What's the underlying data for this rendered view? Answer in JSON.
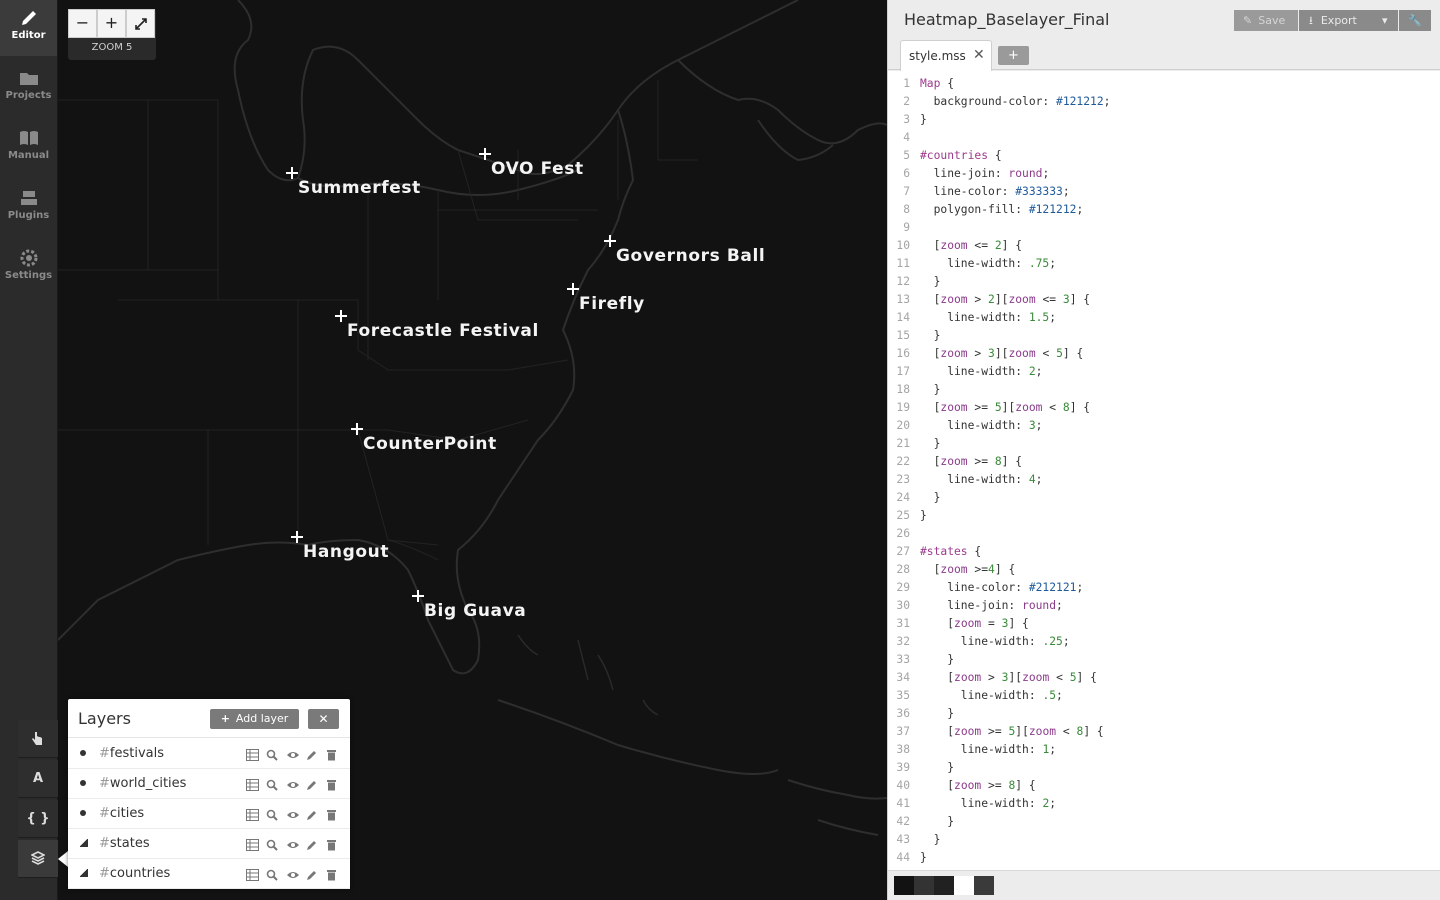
{
  "sidebar": {
    "items": [
      {
        "label": "Editor",
        "icon": "pencil-icon"
      },
      {
        "label": "Projects",
        "icon": "folder-icon"
      },
      {
        "label": "Manual",
        "icon": "book-icon"
      },
      {
        "label": "Plugins",
        "icon": "plugin-icon"
      },
      {
        "label": "Settings",
        "icon": "gear-icon"
      }
    ],
    "tools": [
      {
        "name": "hand-tool",
        "glyph": ""
      },
      {
        "name": "font-tool",
        "glyph": "A"
      },
      {
        "name": "docs-tool",
        "glyph": "{ }"
      },
      {
        "name": "layers-tool",
        "glyph": ""
      }
    ]
  },
  "map": {
    "zoom_minus": "−",
    "zoom_plus": "+",
    "zoom_label": "ZOOM 5",
    "festivals": [
      {
        "name": "Summerfest"
      },
      {
        "name": "OVO Fest"
      },
      {
        "name": "Governors Ball"
      },
      {
        "name": "Firefly"
      },
      {
        "name": "Forecastle Festival"
      },
      {
        "name": "CounterPoint"
      },
      {
        "name": "Hangout"
      },
      {
        "name": "Big Guava"
      }
    ],
    "colors": {
      "background": "#121212",
      "lines": "#333333",
      "state_lines": "#262626",
      "labels": "#ffffff"
    }
  },
  "layers_panel": {
    "title": "Layers",
    "add_label": "Add layer",
    "close_glyph": "✕",
    "hash": "#",
    "layers": [
      {
        "name": "festivals",
        "geometry": "point"
      },
      {
        "name": "world_cities",
        "geometry": "point"
      },
      {
        "name": "cities",
        "geometry": "point"
      },
      {
        "name": "states",
        "geometry": "polygon"
      },
      {
        "name": "countries",
        "geometry": "polygon"
      }
    ]
  },
  "editor": {
    "project_title": "Heatmap_Baselayer_Final",
    "save_label": "Save",
    "export_label": "Export",
    "tab_name": "style.mss",
    "tab_close": "✕",
    "add_tab": "+",
    "code_lines": [
      "Map {",
      "  background-color: #121212;",
      "}",
      "",
      "#countries {",
      "  line-join: round;",
      "  line-color: #333333;",
      "  polygon-fill: #121212;",
      "",
      "  [zoom <= 2] {",
      "    line-width: .75;",
      "  }",
      "  [zoom > 2][zoom <= 3] {",
      "    line-width: 1.5;",
      "  }",
      "  [zoom > 3][zoom < 5] {",
      "    line-width: 2;",
      "  }",
      "  [zoom >= 5][zoom < 8] {",
      "    line-width: 3;",
      "  }",
      "  [zoom >= 8] {",
      "    line-width: 4;",
      "  }",
      "}",
      "",
      "#states {",
      "  [zoom >=4] {",
      "    line-color: #212121;",
      "    line-join: round;",
      "    [zoom = 3] {",
      "      line-width: .25;",
      "    }",
      "    [zoom > 3][zoom < 5] {",
      "      line-width: .5;",
      "    }",
      "    [zoom >= 5][zoom < 8] {",
      "      line-width: 1;",
      "    }",
      "    [zoom >= 8] {",
      "      line-width: 2;",
      "    }",
      "  }",
      "}"
    ],
    "swatches": [
      "#121212",
      "#333333",
      "#212121",
      "#ffffff",
      "#3a3a3a"
    ]
  }
}
